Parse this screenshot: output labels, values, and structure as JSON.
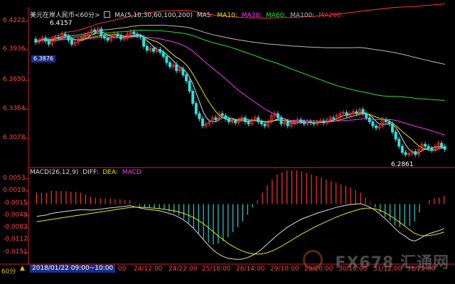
{
  "header": {
    "symbol": "美元在岸人民币<60分>",
    "ma_label": "MA(5,10,30,60,100,200)",
    "ma_items": [
      {
        "label": "MA5:",
        "color": "#dddddd"
      },
      {
        "label": "MA10:",
        "color": "#e8e800"
      },
      {
        "label": "MA30:",
        "color": "#ff33ff"
      },
      {
        "label": "MA60:",
        "color": "#33dd33"
      },
      {
        "label": "MA100:",
        "color": "#bbbbbb"
      },
      {
        "label": "MA200:",
        "color": "#ff3333"
      }
    ],
    "fav_icon": "square-grid-icon"
  },
  "price_axis": {
    "ticks": [
      "6.4222",
      "6.3936",
      "6.3650",
      "6.3364",
      "6.3078"
    ],
    "current_tag": "6.3876",
    "high_label": "6.4157",
    "low_label": "6.2861"
  },
  "macd": {
    "label": "MACD(26,12,9)",
    "diff_label": "DIFF:",
    "dea_label": "DEA:",
    "macd_label": "MACD",
    "ticks": [
      "0.0053",
      "0.0019",
      "-0.0015",
      "-0.0049",
      "-0.0083",
      "-0.0117",
      "-0.0151"
    ]
  },
  "time_axis": {
    "period_button": "60分",
    "cursor_time": "2018/01/22 09:00~10:00",
    "labels": [
      "00",
      "24/12:00",
      "24/22:00",
      "25/18:00",
      "26/14:00",
      "29/10:00",
      "29/20:00",
      "30/16:00",
      "31/12:00",
      "31/22:00"
    ]
  },
  "watermark": "FX678 汇通网",
  "colors": {
    "up": "#ff3333",
    "down": "#33dddd",
    "axis": "#cc2222",
    "diff": "#dddddd",
    "dea": "#e8e800",
    "macd_pos": "#ff3333",
    "macd_neg": "#33cccc"
  },
  "chart_data": [
    {
      "type": "candlestick",
      "title": "美元在岸人民币<60分>",
      "ylim": [
        6.28,
        6.426
      ],
      "close": [
        6.4,
        6.402,
        6.404,
        6.401,
        6.398,
        6.402,
        6.405,
        6.404,
        6.408,
        6.406,
        6.402,
        6.398,
        6.4,
        6.403,
        6.405,
        6.407,
        6.409,
        6.412,
        6.41,
        6.413,
        6.406,
        6.404,
        6.402,
        6.405,
        6.408,
        6.406,
        6.403,
        6.404,
        6.408,
        6.41,
        6.408,
        6.406,
        6.405,
        6.396,
        6.392,
        6.394,
        6.391,
        6.393,
        6.39,
        6.386,
        6.38,
        6.376,
        6.378,
        6.372,
        6.374,
        6.368,
        6.362,
        6.352,
        6.34,
        6.33,
        6.325,
        6.318,
        6.32,
        6.322,
        6.326,
        6.324,
        6.33,
        6.328,
        6.325,
        6.322,
        6.323,
        6.321,
        6.324,
        6.326,
        6.322,
        6.32,
        6.324,
        6.326,
        6.322,
        6.32,
        6.318,
        6.322,
        6.328,
        6.33,
        6.326,
        6.32,
        6.322,
        6.318,
        6.32,
        6.322,
        6.324,
        6.322,
        6.32,
        6.322,
        6.321,
        6.32,
        6.322,
        6.323,
        6.321,
        6.324,
        6.326,
        6.325,
        6.328,
        6.33,
        6.331,
        6.328,
        6.33,
        6.332,
        6.33,
        6.334,
        6.33,
        6.326,
        6.322,
        6.318,
        6.316,
        6.318,
        6.324,
        6.322,
        6.32,
        6.312,
        6.305,
        6.298,
        6.292,
        6.29,
        6.291,
        6.293,
        6.29,
        6.295,
        6.3,
        6.298,
        6.296,
        6.294,
        6.298,
        6.301,
        6.298,
        6.295
      ],
      "open_offset": 0.003,
      "highlights": [
        {
          "index": 14,
          "label": "6.4157"
        },
        {
          "index": 114,
          "label": "6.2861"
        }
      ]
    },
    {
      "type": "line",
      "title": "MACD(26,12,9)",
      "series": [
        {
          "name": "DIFF",
          "values": [
            -0.0048,
            -0.0046,
            -0.0044,
            -0.004,
            -0.0038,
            -0.0036,
            -0.0034,
            -0.0033,
            -0.0031,
            -0.003,
            -0.003,
            -0.0031,
            -0.003,
            -0.0029,
            -0.0027,
            -0.0025,
            -0.0024,
            -0.0022,
            -0.0021,
            -0.0019,
            -0.0022,
            -0.0025,
            -0.0028,
            -0.003,
            -0.0031,
            -0.0033,
            -0.0036,
            -0.004,
            -0.0044,
            -0.005,
            -0.0058,
            -0.0068,
            -0.008,
            -0.0095,
            -0.011,
            -0.0125,
            -0.0138,
            -0.0148,
            -0.0155,
            -0.016,
            -0.0162,
            -0.0163,
            -0.0162,
            -0.0158,
            -0.0152,
            -0.0144,
            -0.0134,
            -0.0122,
            -0.011,
            -0.0098,
            -0.0088,
            -0.0078,
            -0.007,
            -0.0062,
            -0.0055,
            -0.005,
            -0.0045,
            -0.004,
            -0.0036,
            -0.0032,
            -0.0028,
            -0.0024,
            -0.0021,
            -0.0018,
            -0.0016,
            -0.0015,
            -0.0014,
            -0.0018,
            -0.0024,
            -0.0032,
            -0.0042,
            -0.0054,
            -0.0066,
            -0.008,
            -0.0092,
            -0.01,
            -0.011,
            -0.0114,
            -0.0108,
            -0.01,
            -0.0094,
            -0.009,
            -0.0086,
            -0.008
          ]
        },
        {
          "name": "DEA",
          "values": [
            -0.0062,
            -0.006,
            -0.0058,
            -0.0056,
            -0.0054,
            -0.0052,
            -0.005,
            -0.0048,
            -0.0046,
            -0.0044,
            -0.0042,
            -0.004,
            -0.0038,
            -0.0036,
            -0.0034,
            -0.0032,
            -0.003,
            -0.0028,
            -0.0026,
            -0.0024,
            -0.0023,
            -0.0023,
            -0.0024,
            -0.0025,
            -0.0026,
            -0.0027,
            -0.0029,
            -0.0031,
            -0.0033,
            -0.0036,
            -0.004,
            -0.0045,
            -0.0051,
            -0.0059,
            -0.0068,
            -0.0078,
            -0.0089,
            -0.01,
            -0.011,
            -0.012,
            -0.0128,
            -0.0135,
            -0.0141,
            -0.0145,
            -0.0148,
            -0.0149,
            -0.0148,
            -0.0145,
            -0.014,
            -0.0134,
            -0.0127,
            -0.0119,
            -0.0111,
            -0.0103,
            -0.0095,
            -0.0088,
            -0.0081,
            -0.0074,
            -0.0068,
            -0.0062,
            -0.0056,
            -0.005,
            -0.0045,
            -0.004,
            -0.0036,
            -0.0032,
            -0.0028,
            -0.0026,
            -0.0026,
            -0.0028,
            -0.0032,
            -0.0038,
            -0.0046,
            -0.0054,
            -0.0064,
            -0.0074,
            -0.0084,
            -0.0093,
            -0.0098,
            -0.01,
            -0.0099,
            -0.0097,
            -0.0094,
            -0.009
          ]
        }
      ],
      "ylim": [
        -0.0168,
        0.006
      ]
    }
  ]
}
